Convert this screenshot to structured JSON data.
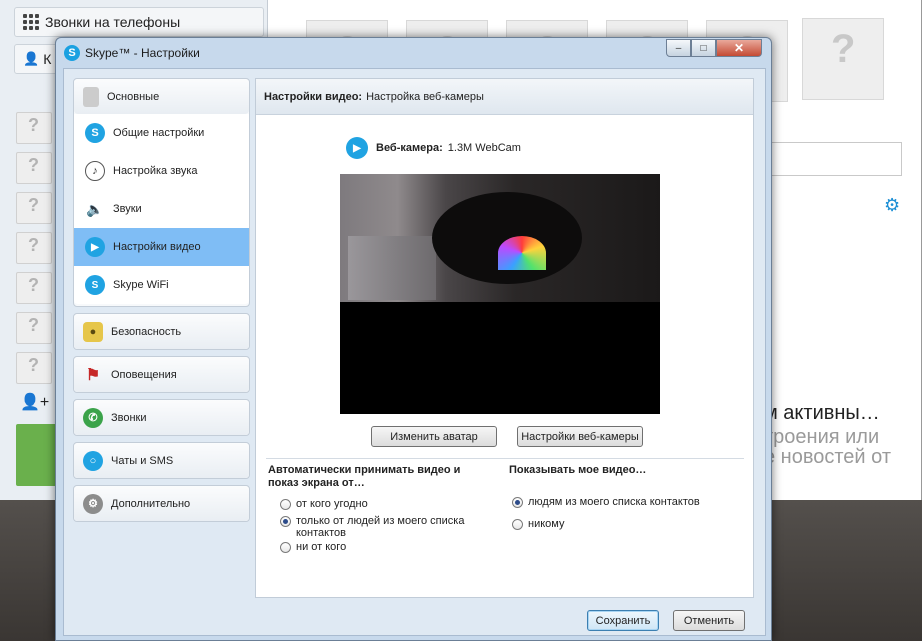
{
  "background": {
    "tab_label": "Звонки на телефоны",
    "partial_tab_label": "К",
    "status_lines": [
      "м активны…",
      "троения или",
      "е новостей от"
    ]
  },
  "dialog": {
    "title": "Skype™ - Настройки",
    "controls": {
      "minimize": "–",
      "maximize": "□",
      "close": "✕"
    }
  },
  "sidebar": {
    "groups": [
      {
        "label": "Основные",
        "icon": "general-icon",
        "items": [
          {
            "label": "Общие настройки",
            "icon": "skype-icon"
          },
          {
            "label": "Настройка звука",
            "icon": "sound-settings-icon"
          },
          {
            "label": "Звуки",
            "icon": "speaker-icon"
          },
          {
            "label": "Настройки видео",
            "icon": "video-icon",
            "active": true
          },
          {
            "label": "Skype WiFi",
            "icon": "wifi-icon"
          }
        ]
      },
      {
        "label": "Безопасность",
        "icon": "lock-icon"
      },
      {
        "label": "Оповещения",
        "icon": "flag-icon"
      },
      {
        "label": "Звонки",
        "icon": "phone-icon"
      },
      {
        "label": "Чаты и SMS",
        "icon": "chat-icon"
      },
      {
        "label": "Дополнительно",
        "icon": "gear-icon"
      }
    ]
  },
  "panel": {
    "header_bold": "Настройки видео:",
    "header_text": "Настройка веб-камеры",
    "webcam_label": "Веб-камера:",
    "webcam_value": "1.3M WebCam",
    "change_avatar_button": "Изменить аватар",
    "webcam_settings_button": "Настройки веб-камеры",
    "auto_accept": {
      "title": "Автоматически принимать видео и показ экрана от…",
      "options": [
        {
          "label": "от кого угодно",
          "checked": false
        },
        {
          "label": "только от людей из моего списка контактов",
          "checked": true
        },
        {
          "label": "ни от кого",
          "checked": false
        }
      ]
    },
    "show_video": {
      "title": "Показывать мое видео…",
      "options": [
        {
          "label": "людям из моего списка контактов",
          "checked": true
        },
        {
          "label": "никому",
          "checked": false
        }
      ]
    }
  },
  "footer": {
    "save_button": "Сохранить",
    "cancel_button": "Отменить"
  }
}
